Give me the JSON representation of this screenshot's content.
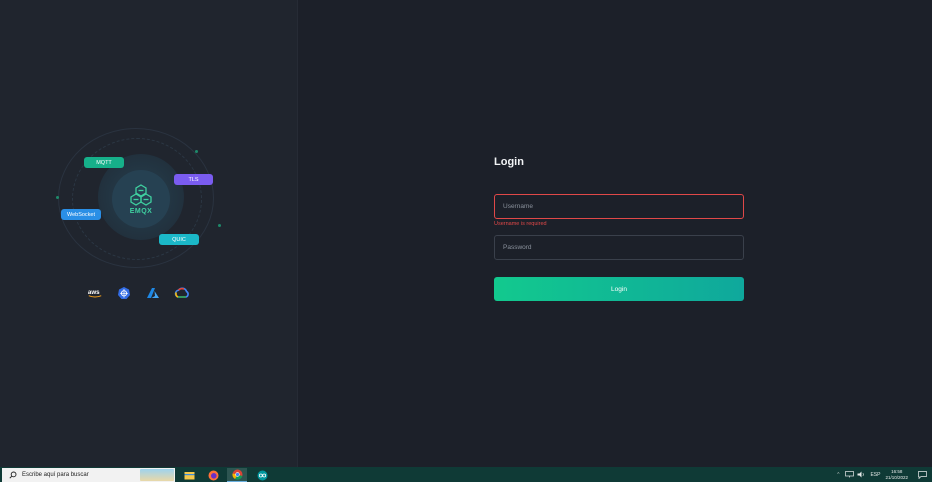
{
  "brand": {
    "core_label": "EMQX",
    "protocols": [
      "MQTT",
      "TLS",
      "WebSocket",
      "QUIC"
    ],
    "cloud_logos": [
      "aws-logo",
      "kubernetes-logo",
      "azure-logo",
      "google-cloud-logo"
    ],
    "aws_text": "aws"
  },
  "login": {
    "title": "Login",
    "username_placeholder": "Username",
    "username_error": "Username is required",
    "password_placeholder": "Password",
    "button_label": "Login"
  },
  "taskbar": {
    "search_placeholder": "Escribe aquí para buscar",
    "apps": [
      "file-explorer",
      "firefox",
      "chrome",
      "arduino"
    ],
    "tray": {
      "language": "ESP",
      "time": "16:58",
      "date": "21/10/2022"
    }
  },
  "colors": {
    "accent": "#12c98e",
    "error": "#e04848",
    "mqtt": "#16b08a",
    "tls": "#7a5cf0",
    "websocket": "#2a8fe6",
    "quic": "#1bb8c8"
  }
}
